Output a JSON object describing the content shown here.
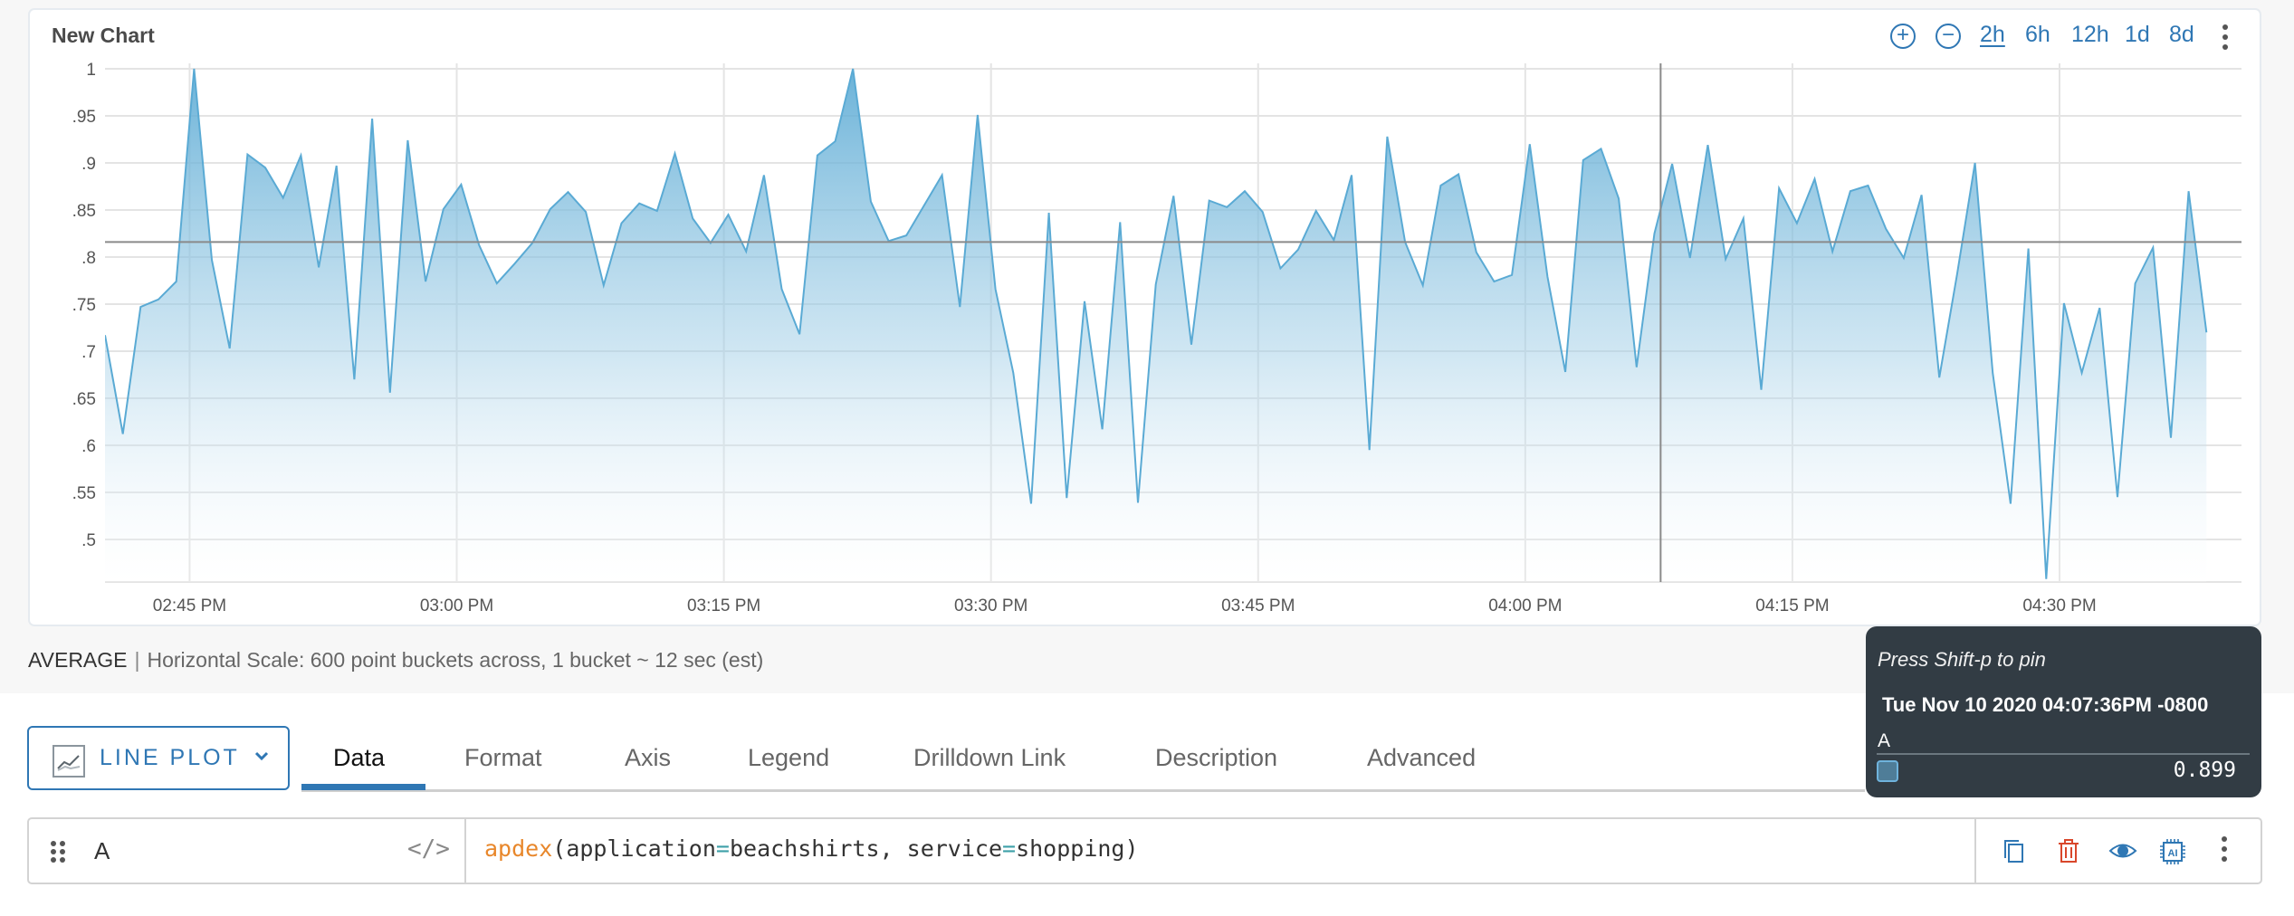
{
  "chart_header": {
    "title": "New Chart",
    "zoom_in_icon": "plus-circle-icon",
    "zoom_out_icon": "minus-circle-icon",
    "ranges": [
      {
        "label": "2h",
        "active": true
      },
      {
        "label": "6h",
        "active": false
      },
      {
        "label": "12h",
        "active": false
      },
      {
        "label": "1d",
        "active": false
      },
      {
        "label": "8d",
        "active": false
      }
    ],
    "more_icon": "kebab-vertical-icon"
  },
  "chart_data": {
    "type": "area",
    "title": "New Chart",
    "xlabel": "",
    "ylabel": "",
    "ylim": [
      0.455,
      1.0
    ],
    "yticks": [
      1,
      0.95,
      0.9,
      0.85,
      0.8,
      0.75,
      0.7,
      0.65,
      0.6,
      0.55,
      0.5
    ],
    "ytick_labels": [
      "1",
      ".95",
      ".9",
      ".85",
      ".8",
      ".75",
      ".7",
      ".65",
      ".6",
      ".55",
      ".5"
    ],
    "xlim": [
      "02:40:15 PM",
      "04:40:13 PM"
    ],
    "xticks": [
      "02:45 PM",
      "03:00 PM",
      "03:15 PM",
      "03:30 PM",
      "03:45 PM",
      "04:00 PM",
      "04:15 PM",
      "04:30 PM"
    ],
    "grid": true,
    "legend": "none",
    "series": [
      {
        "name": "A",
        "color": "#5aaad4",
        "x_start": "02:40:15 PM",
        "interval_minutes": 1,
        "values": [
          0.717,
          0.612,
          0.747,
          0.755,
          0.774,
          1.0,
          0.797,
          0.703,
          0.909,
          0.895,
          0.863,
          0.908,
          0.789,
          0.897,
          0.67,
          0.947,
          0.656,
          0.924,
          0.774,
          0.851,
          0.877,
          0.813,
          0.772,
          0.793,
          0.815,
          0.851,
          0.869,
          0.848,
          0.77,
          0.836,
          0.857,
          0.849,
          0.91,
          0.841,
          0.815,
          0.845,
          0.806,
          0.887,
          0.766,
          0.718,
          0.908,
          0.923,
          1.0,
          0.859,
          0.817,
          0.823,
          0.855,
          0.887,
          0.747,
          0.951,
          0.766,
          0.677,
          0.538,
          0.847,
          0.544,
          0.753,
          0.617,
          0.837,
          0.539,
          0.771,
          0.865,
          0.707,
          0.86,
          0.853,
          0.87,
          0.848,
          0.788,
          0.808,
          0.849,
          0.818,
          0.887,
          0.595,
          0.928,
          0.816,
          0.77,
          0.876,
          0.888,
          0.805,
          0.774,
          0.781,
          0.92,
          0.779,
          0.678,
          0.903,
          0.915,
          0.862,
          0.683,
          0.825,
          0.899,
          0.799,
          0.919,
          0.798,
          0.841,
          0.659,
          0.873,
          0.836,
          0.883,
          0.806,
          0.87,
          0.876,
          0.83,
          0.799,
          0.866,
          0.672,
          0.782,
          0.9,
          0.677,
          0.538,
          0.809,
          0.458,
          0.751,
          0.677,
          0.746,
          0.545,
          0.772,
          0.81,
          0.608,
          0.87,
          0.72
        ]
      }
    ],
    "crosshair": {
      "time": "04:07:36 PM",
      "value": 0.816
    }
  },
  "summary": {
    "aggregation": "AVERAGE",
    "separator": "|",
    "scale_text": "Horizontal Scale: 600 point buckets across, 1 bucket ~ 12 sec (est)"
  },
  "toolbar": {
    "chart_type_label": "LINE PLOT",
    "chart_type_icon": "line-chart-icon",
    "tabs": [
      {
        "label": "Data",
        "active": true
      },
      {
        "label": "Format",
        "active": false
      },
      {
        "label": "Axis",
        "active": false
      },
      {
        "label": "Legend",
        "active": false
      },
      {
        "label": "Drilldown Link",
        "active": false
      },
      {
        "label": "Description",
        "active": false
      },
      {
        "label": "Advanced",
        "active": false
      }
    ]
  },
  "query": {
    "name": "A",
    "code_toggle": "</>",
    "function": "apdex",
    "open_paren": "(",
    "arg1_key": "application",
    "arg1_eq": "=",
    "arg1_val": "beachshirts, ",
    "arg2_key": "service",
    "arg2_eq": "=",
    "arg2_val": "shopping",
    "close_paren": ")",
    "actions": [
      "copy-icon",
      "delete-icon",
      "visibility-eye-icon",
      "ai-chip-icon",
      "kebab-vertical-icon"
    ],
    "colors": {
      "function": "#e8872b",
      "operator": "#3ea0a8",
      "accent": "#2f77b4",
      "danger": "#d9472b"
    }
  },
  "tooltip": {
    "hint": "Press Shift-p to pin",
    "timestamp": "Tue Nov 10 2020 04:07:36PM -0800",
    "series_label": "A",
    "value": "0.899",
    "swatch_color": "#4f7d98"
  }
}
